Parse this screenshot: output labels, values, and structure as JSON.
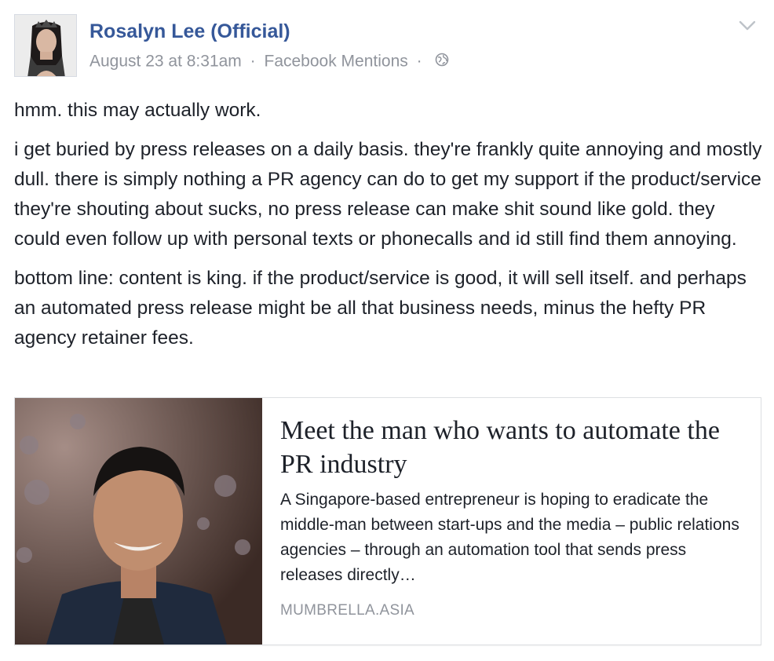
{
  "post": {
    "author_name": "Rosalyn Lee (Official)",
    "timestamp": "August 23 at 8:31am",
    "separator": "·",
    "source": "Facebook Mentions",
    "privacy_icon": "globe-icon",
    "menu_icon": "chevron-down-icon",
    "paragraphs": [
      "hmm. this may actually work.",
      "i get buried by press releases on a daily basis. they're frankly quite annoying and mostly dull. there is simply nothing a PR agency can do to get my support if the product/service they're shouting about sucks, no press release can make shit sound like gold. they could even follow up with personal texts or phonecalls and id still find them annoying.",
      "bottom line: content is king. if the product/service is good, it will sell itself. and perhaps an automated press release might be all that business needs, minus the hefty PR agency retainer fees."
    ]
  },
  "link_preview": {
    "title": "Meet the man who wants to automate the PR industry",
    "description": "A Singapore-based entrepreneur is hoping to eradicate the middle-man between start-ups and the media – public relations agencies – through an automation tool that sends press releases directly…",
    "domain": "MUMBRELLA.ASIA"
  },
  "colors": {
    "author_link": "#365899",
    "meta_text": "#90949c",
    "body_text": "#1d2129",
    "card_border": "#dddfe2"
  }
}
